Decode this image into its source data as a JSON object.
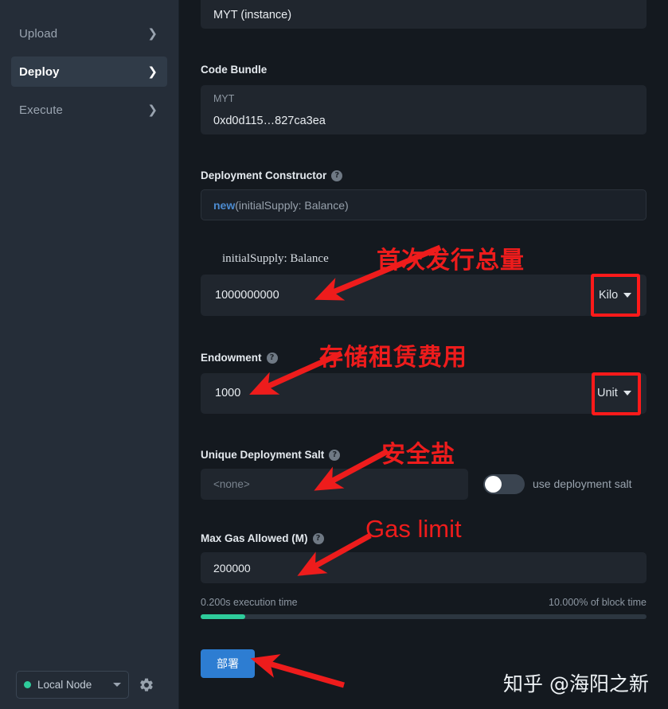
{
  "sidebar": {
    "items": [
      {
        "label": "Upload",
        "icon": "chevron-right-icon",
        "active": false
      },
      {
        "label": "Deploy",
        "icon": "chevron-right-icon",
        "active": true
      },
      {
        "label": "Execute",
        "icon": "chevron-right-icon",
        "active": false
      }
    ],
    "node": {
      "name": "Local Node",
      "status_color": "#2ecc9b",
      "caret_icon": "chevron-down-icon",
      "settings_icon": "gear-icon"
    }
  },
  "main": {
    "instance_field": {
      "value": "MYT (instance)"
    },
    "code_bundle": {
      "label": "Code Bundle",
      "name": "MYT",
      "hash": "0xd0d115…827ca3ea"
    },
    "deployment_constructor": {
      "label": "Deployment Constructor",
      "help_icon": "help-circle-icon",
      "keyword": "new",
      "signature": "(initialSupply: Balance)"
    },
    "initial_supply": {
      "label": "initialSupply: Balance",
      "value": "1000000000",
      "unit": "Kilo",
      "unit_caret_icon": "caret-down-icon"
    },
    "endowment": {
      "label": "Endowment",
      "help_icon": "help-circle-icon",
      "value": "1000",
      "unit": "Unit",
      "unit_caret_icon": "caret-down-icon"
    },
    "salt": {
      "label": "Unique Deployment Salt",
      "help_icon": "help-circle-icon",
      "placeholder": "<none>",
      "toggle_label": "use deployment salt",
      "toggle_on": false
    },
    "max_gas": {
      "label": "Max Gas Allowed (M)",
      "help_icon": "help-circle-icon",
      "value": "200000",
      "execution_time": "0.200s execution time",
      "block_time": "10.000% of block time",
      "progress_percent": 10,
      "progress_color": "#2ecc9b"
    },
    "deploy_button": {
      "label": "部署",
      "color": "#2d7dd2"
    }
  },
  "annotations": [
    {
      "text": "首次发行总量",
      "lang": "cn"
    },
    {
      "text": "存储租赁费用",
      "lang": "cn"
    },
    {
      "text": "安全盐",
      "lang": "cn"
    },
    {
      "text": "Gas limit",
      "lang": "en"
    }
  ],
  "watermark": {
    "text": "知乎 @海阳之新"
  },
  "colors": {
    "sidebar_bg": "#252d38",
    "main_bg": "#14191f",
    "field_bg": "#20262e",
    "accent_blue": "#2d7dd2",
    "annotation_red": "#ee1c1c",
    "progress_green": "#2ecc9b"
  }
}
